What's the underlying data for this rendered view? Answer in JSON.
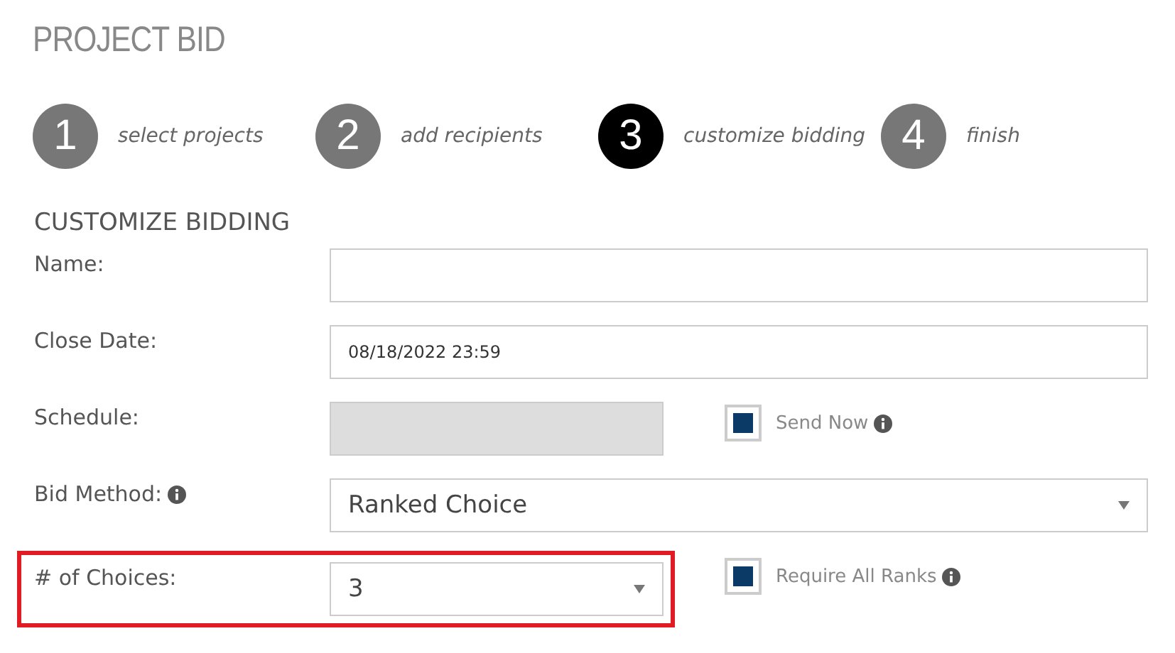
{
  "title": "PROJECT BID",
  "steps": [
    {
      "number": "1",
      "label": "select projects",
      "selected": false
    },
    {
      "number": "2",
      "label": "add recipients",
      "selected": false
    },
    {
      "number": "3",
      "label": "customize bidding",
      "selected": true
    },
    {
      "number": "4",
      "label": "finish",
      "selected": false
    }
  ],
  "section_title": "CUSTOMIZE BIDDING",
  "fields": [
    {
      "label": "Name:",
      "kind": "text",
      "info": false,
      "highlighted": false
    },
    {
      "label": "Close Date:",
      "kind": "text",
      "value": "08/18/2022 23:59",
      "info": false,
      "highlighted": false
    },
    {
      "label": "Schedule:",
      "kind": "disabled",
      "info": false,
      "highlighted": false,
      "checkbox": {
        "label": "Send Now",
        "checked": true,
        "info": true
      }
    },
    {
      "label": "Bid Method:",
      "kind": "select",
      "value": "Ranked Choice",
      "info": true,
      "highlighted": false
    },
    {
      "label": "# of Choices:",
      "kind": "select-short",
      "value": "3",
      "info": false,
      "highlighted": true,
      "checkbox": {
        "label": "Require All Ranks",
        "checked": true,
        "info": true
      }
    }
  ]
}
